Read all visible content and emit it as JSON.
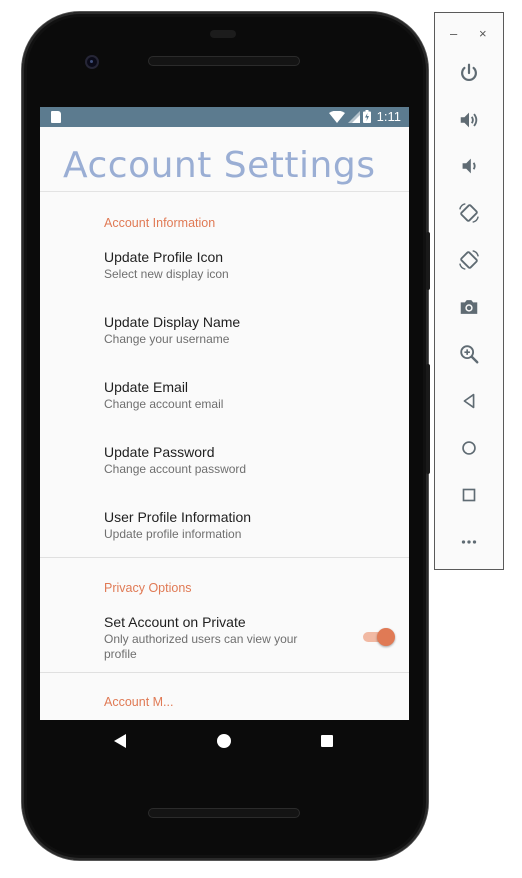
{
  "status_bar": {
    "time": "1:11"
  },
  "page": {
    "title": "Account Settings"
  },
  "sections": [
    {
      "header": "Account Information",
      "items": [
        {
          "title": "Update Profile Icon",
          "summary": "Select new display icon"
        },
        {
          "title": "Update Display Name",
          "summary": "Change your username"
        },
        {
          "title": "Update Email",
          "summary": "Change account email"
        },
        {
          "title": "Update Password",
          "summary": "Change account password"
        },
        {
          "title": "User Profile Information",
          "summary": "Update profile information"
        }
      ]
    },
    {
      "header": "Privacy Options",
      "items": [
        {
          "title": "Set Account on Private",
          "summary": "Only authorized users can view your profile",
          "switch_on": true
        }
      ]
    },
    {
      "header": "Account M..."
    }
  ],
  "colors": {
    "accent": "#e07a55",
    "title": "#9aaed4",
    "status_bar": "#5c7b8f"
  },
  "emulator_toolbar": {
    "window_controls": [
      "–",
      "×"
    ],
    "buttons": [
      "power-icon",
      "volume-up-icon",
      "volume-down-icon",
      "rotate-left-icon",
      "rotate-right-icon",
      "camera-icon",
      "zoom-icon",
      "back-icon",
      "home-icon",
      "overview-icon",
      "more-icon"
    ]
  }
}
